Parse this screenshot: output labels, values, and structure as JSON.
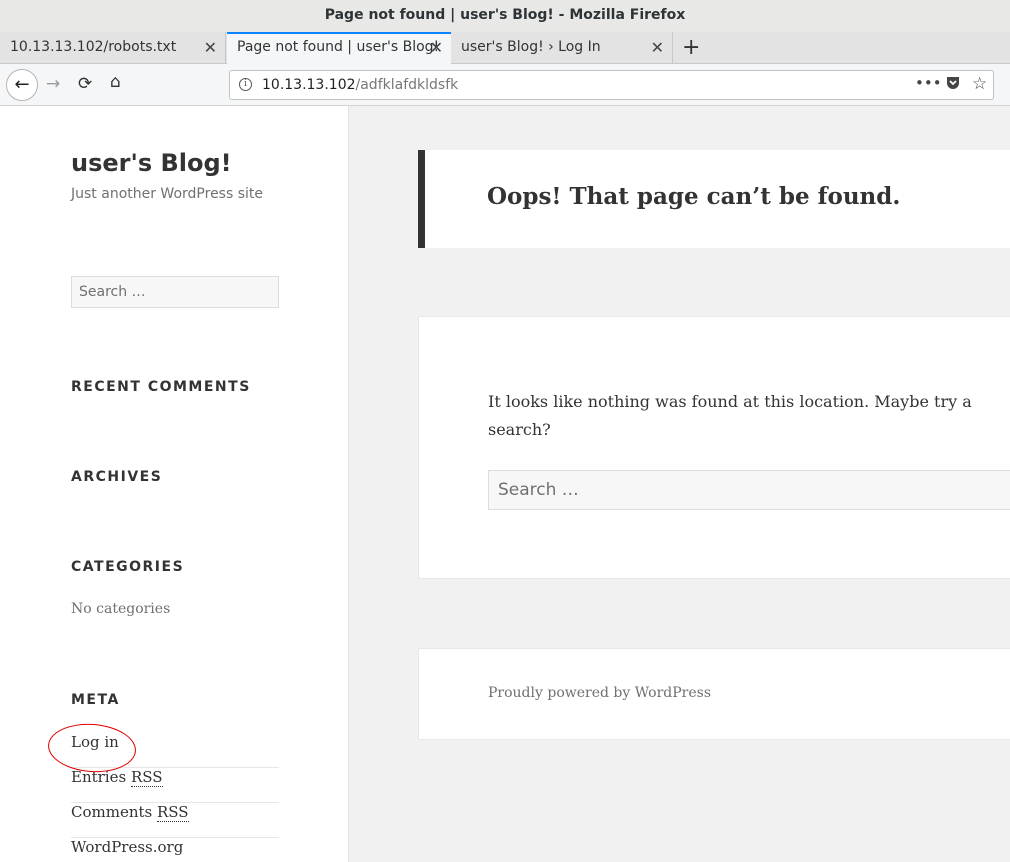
{
  "window": {
    "title": "Page not found | user's Blog! - Mozilla Firefox"
  },
  "tabs": [
    {
      "label": "10.13.13.102/robots.txt"
    },
    {
      "label": "Page not found | user's Blog!"
    },
    {
      "label": "user's Blog! › Log In"
    }
  ],
  "tab_close_glyph": "✕",
  "new_tab_glyph": "+",
  "address": {
    "host": "10.13.13.102",
    "path": "/adfklafdkldsfk"
  },
  "site": {
    "title": "user's Blog!",
    "description": "Just another WordPress site"
  },
  "sidebar": {
    "search_placeholder": "Search …",
    "recent_comments_title": "RECENT COMMENTS",
    "archives_title": "ARCHIVES",
    "categories_title": "CATEGORIES",
    "categories_empty": "No categories",
    "meta_title": "META",
    "meta_links": {
      "login": "Log in",
      "entries_prefix": "Entries ",
      "comments_prefix": "Comments ",
      "rss": "RSS",
      "wordpress": "WordPress.org"
    }
  },
  "main": {
    "heading": "Oops! That page can’t be found.",
    "message": "It looks like nothing was found at this location. Maybe try a search?",
    "search_placeholder": "Search …",
    "footer_credit": "Proudly powered by WordPress"
  },
  "annotation": {
    "color": "#e00000"
  },
  "colors": {
    "tab_accent": "#0a84ff",
    "page_bg": "#f1f1f1"
  }
}
